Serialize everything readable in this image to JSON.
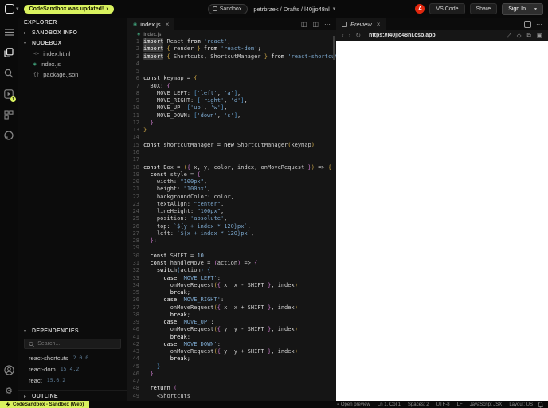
{
  "colors": {
    "accent_lime": "#D9F25F",
    "avatar_red": "#E1270E",
    "editor_bg": "#151515",
    "string_blue": "#7CA8CE",
    "bracket_gold": "#CDA747",
    "bracket_pink": "#C678C6",
    "bracket_blue": "#5B9FD6",
    "js_icon_teal": "#3F9E78"
  },
  "icons": {
    "update_chevron": "›",
    "caret_down": "▾",
    "caret_right": "▸",
    "close": "×",
    "more": "⋯",
    "split": "◫",
    "back": "‹",
    "forward": "›",
    "reload": "↻",
    "expand": "⤢",
    "crosshair": "◇",
    "new_window": "⧉",
    "screenshot": "▣",
    "js_file": "◉",
    "html_file": "<>",
    "json_file": "{}",
    "topbar_caret": "▾",
    "gear": "⚙"
  },
  "topbar": {
    "update_pill": "CodeSandbox was updated!",
    "sandbox_badge": "Sandbox",
    "breadcrumb": "petrbrzek / Drafts / l40jjo48nl",
    "avatar_letter": "A",
    "vscode_button": "VS Code",
    "share_button": "Share",
    "signin_button": "Sign In"
  },
  "sidebar": {
    "explorer_title": "EXPLORER",
    "sandbox_info": "SANDBOX INFO",
    "nodebox": "NODEBOX",
    "dependencies_title": "DEPENDENCIES",
    "outline": "OUTLINE",
    "search_placeholder": "Search...",
    "files": [
      {
        "name": "index.html",
        "icon": "html-file-icon",
        "glyph": "<>"
      },
      {
        "name": "index.js",
        "icon": "js-file-icon",
        "glyph": "◉"
      },
      {
        "name": "package.json",
        "icon": "json-file-icon",
        "glyph": "{}"
      }
    ],
    "dependencies": [
      {
        "name": "react-shortcuts",
        "version": "2.0.0"
      },
      {
        "name": "react-dom",
        "version": "15.4.2"
      },
      {
        "name": "react",
        "version": "15.6.2"
      }
    ]
  },
  "editor": {
    "tab": "index.js",
    "breadcrumb_file": "index.js",
    "code_lines": [
      "import React from 'react';",
      "import { render } from 'react-dom';",
      "import { Shortcuts, ShortcutManager } from 'react-shortcuts'",
      "",
      "",
      "const keymap = {",
      "  BOX: {",
      "    MOVE_LEFT: ['left', 'a'],",
      "    MOVE_RIGHT: ['right', 'd'],",
      "    MOVE_UP: ['up', 'w'],",
      "    MOVE_DOWN: ['down', 's'],",
      "  }",
      "}",
      "",
      "const shortcutManager = new ShortcutManager(keymap)",
      "",
      "",
      "const Box = ({ x, y, color, index, onMoveRequest }) => {",
      "  const style = {",
      "    width: \"100px\",",
      "    height: \"100px\",",
      "    backgroundColor: color,",
      "    textAlign: \"center\",",
      "    lineHeight: \"100px\",",
      "    position: 'absolute',",
      "    top: `${y + index * 120}px`,",
      "    left: `${x + index * 120}px`,",
      "  };",
      "",
      "  const SHIFT = 10",
      "  const handleMove = (action) => {",
      "    switch(action) {",
      "      case 'MOVE_LEFT':",
      "        onMoveRequest({ x: x - SHIFT }, index)",
      "        break;",
      "      case 'MOVE_RIGHT':",
      "        onMoveRequest({ x: x + SHIFT }, index)",
      "        break;",
      "      case 'MOVE_UP':",
      "        onMoveRequest({ y: y - SHIFT }, index)",
      "        break;",
      "      case 'MOVE_DOWN':",
      "        onMoveRequest({ y: y + SHIFT }, index)",
      "        break;",
      "    }",
      "  }",
      "",
      "  return (",
      "    <Shortcuts"
    ]
  },
  "preview": {
    "tab": "Preview",
    "url": "https://l40jjo48nl.csb.app"
  },
  "statusbar": {
    "left_badge": "CodeSandbox - Sandbox (Web)",
    "items": [
      {
        "icon": "⌁",
        "label": "Open preview"
      },
      {
        "label": "Ln 1, Col 1"
      },
      {
        "label": "Spaces: 2"
      },
      {
        "label": "UTF-8"
      },
      {
        "label": "LF"
      },
      {
        "label": "JavaScript JSX"
      },
      {
        "label": "Layout: US"
      }
    ]
  }
}
